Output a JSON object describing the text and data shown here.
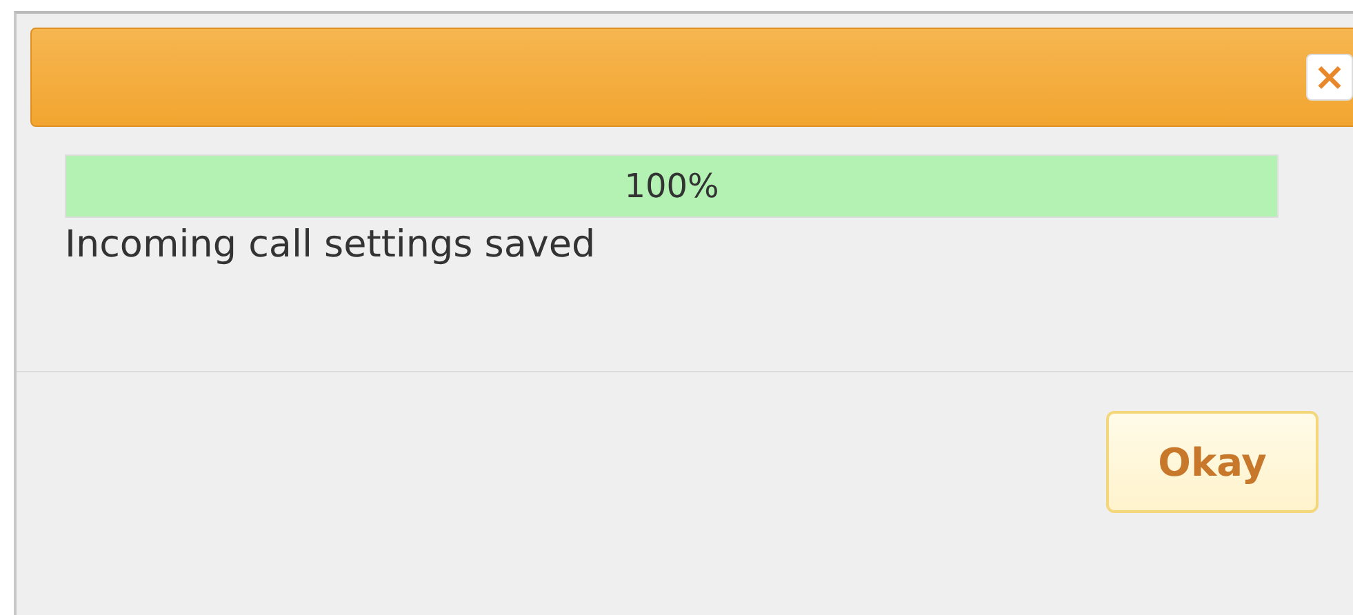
{
  "dialog": {
    "close_button": "×",
    "progress": {
      "level": 1,
      "reading": "100%"
    },
    "message": "Incoming call settings saved",
    "buttons": [
      "Okay"
    ]
  }
}
